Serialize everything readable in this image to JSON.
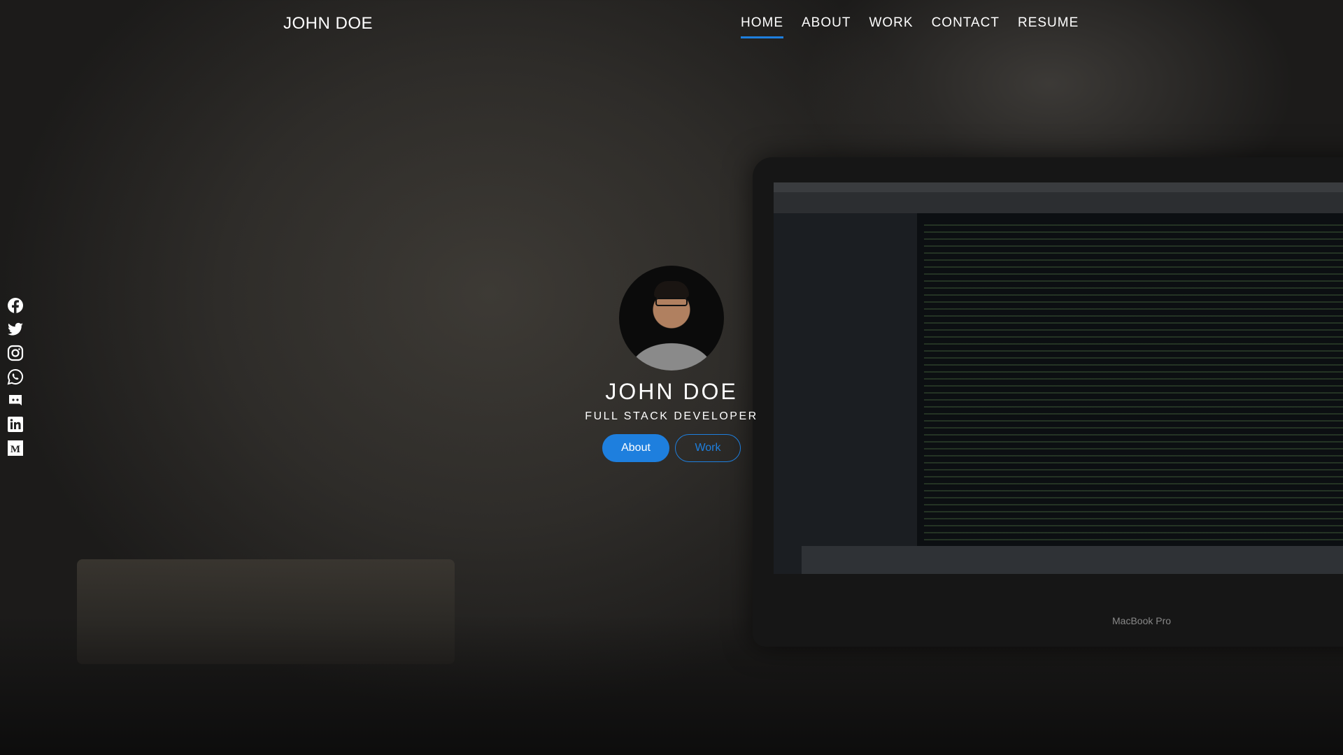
{
  "logo": "JOHN DOE",
  "nav": [
    {
      "label": "HOME",
      "active": true
    },
    {
      "label": "ABOUT"
    },
    {
      "label": "WORK"
    },
    {
      "label": "CONTACT"
    },
    {
      "label": "RESUME"
    }
  ],
  "social": [
    "facebook-icon",
    "twitter-icon",
    "instagram-icon",
    "whatsapp-icon",
    "discord-icon",
    "linkedin-icon",
    "medium-icon"
  ],
  "hero": {
    "name": "JOHN DOE",
    "title": "FULL STACK DEVELOPER",
    "about_button": "About",
    "work_button": "Work"
  },
  "background": {
    "laptop_label": "MacBook Pro"
  },
  "colors": {
    "accent": "#1e7fde"
  }
}
